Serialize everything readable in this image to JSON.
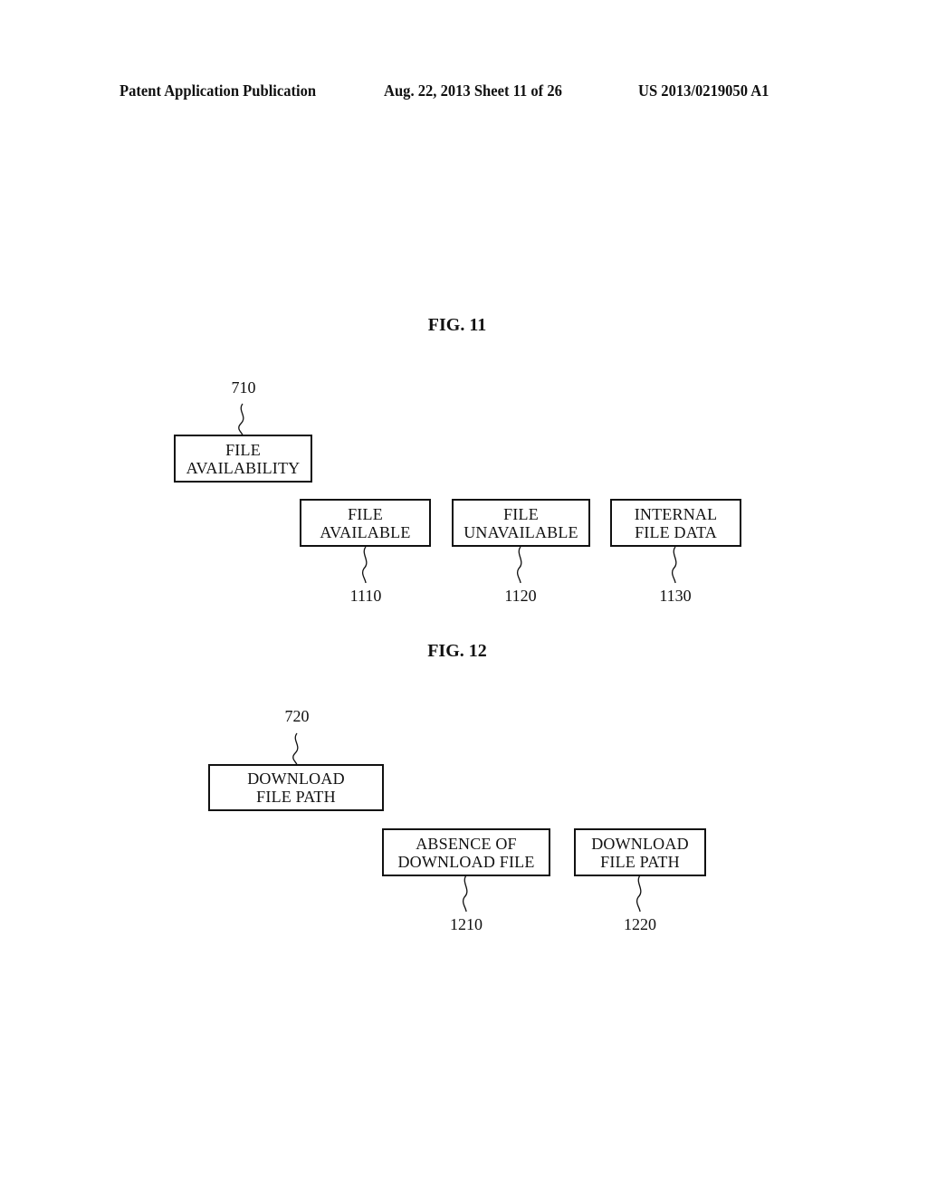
{
  "header": {
    "publication": "Patent Application Publication",
    "date_sheet": "Aug. 22, 2013  Sheet 11 of 26",
    "number": "US 2013/0219050 A1"
  },
  "fig11": {
    "title": "FIG. 11",
    "parent": {
      "ref": "710",
      "line1": "FILE",
      "line2": "AVAILABILITY"
    },
    "children": [
      {
        "ref": "1110",
        "line1": "FILE",
        "line2": "AVAILABLE"
      },
      {
        "ref": "1120",
        "line1": "FILE",
        "line2": "UNAVAILABLE"
      },
      {
        "ref": "1130",
        "line1": "INTERNAL",
        "line2": "FILE DATA"
      }
    ]
  },
  "fig12": {
    "title": "FIG. 12",
    "parent": {
      "ref": "720",
      "line1": "DOWNLOAD",
      "line2": "FILE PATH"
    },
    "children": [
      {
        "ref": "1210",
        "line1": "ABSENCE OF",
        "line2": "DOWNLOAD FILE"
      },
      {
        "ref": "1220",
        "line1": "DOWNLOAD",
        "line2": "FILE PATH"
      }
    ]
  }
}
